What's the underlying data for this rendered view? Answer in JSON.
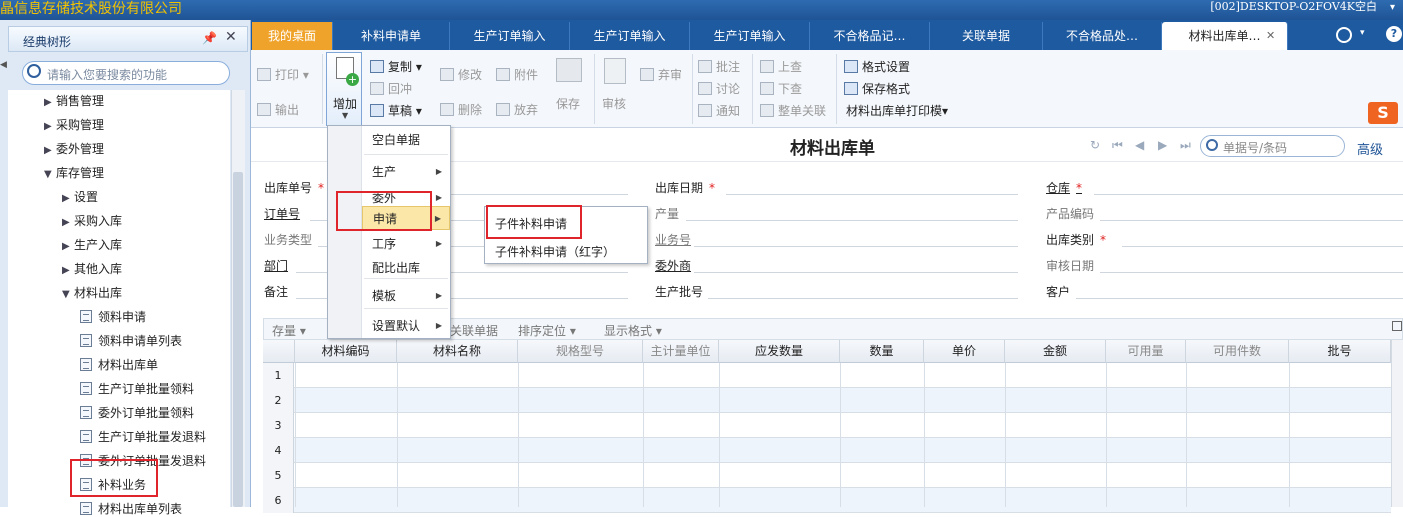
{
  "app": {
    "title": "晶信息存储技术股份有限公司",
    "machine": "[002]DESKTOP-O2FOV4K空白"
  },
  "left_panel": {
    "title": "经典树形",
    "search_placeholder": "请输入您要搜索的功能",
    "tree": [
      {
        "label": "销售管理",
        "level": 1,
        "expanded": false
      },
      {
        "label": "采购管理",
        "level": 1,
        "expanded": false
      },
      {
        "label": "委外管理",
        "level": 1,
        "expanded": false
      },
      {
        "label": "库存管理",
        "level": 1,
        "expanded": true
      },
      {
        "label": "设置",
        "level": 2,
        "expanded": false
      },
      {
        "label": "采购入库",
        "level": 2,
        "expanded": false
      },
      {
        "label": "生产入库",
        "level": 2,
        "expanded": false
      },
      {
        "label": "其他入库",
        "level": 2,
        "expanded": false
      },
      {
        "label": "材料出库",
        "level": 2,
        "expanded": true
      },
      {
        "label": "领料申请",
        "level": 3
      },
      {
        "label": "领料申请单列表",
        "level": 3
      },
      {
        "label": "材料出库单",
        "level": 3
      },
      {
        "label": "生产订单批量领料",
        "level": 3
      },
      {
        "label": "委外订单批量领料",
        "level": 3
      },
      {
        "label": "生产订单批量发退料",
        "level": 3
      },
      {
        "label": "委外订单批量发退料",
        "level": 3
      },
      {
        "label": "补料业务",
        "level": 3,
        "highlighted": true
      },
      {
        "label": "材料出库单列表",
        "level": 3
      }
    ]
  },
  "tabs": [
    "我的桌面",
    "补料申请单",
    "生产订单输入",
    "生产订单输入",
    "生产订单输入",
    "不合格品记…",
    "关联单据",
    "不合格品处…",
    "材料出库单…"
  ],
  "ribbon": {
    "print": "打印",
    "export": "输出",
    "add": "增加",
    "copy": "复制",
    "revert": "回冲",
    "draft": "草稿",
    "modify": "修改",
    "delete": "删除",
    "attach": "附件",
    "abandon": "放弃",
    "save": "保存",
    "audit": "审核",
    "reject": "弃审",
    "annotate": "批注",
    "discuss": "讨论",
    "notify": "通知",
    "up": "上查",
    "down": "下查",
    "link_all": "整单关联",
    "format_setting": "格式设置",
    "save_format": "保存格式",
    "print_template": "材料出库单打印模▾"
  },
  "form": {
    "title": "材料出库单",
    "search_placeholder": "单据号/条码",
    "advanced": "高级",
    "fields": {
      "out_no": "出库单号",
      "out_date": "出库日期",
      "warehouse": "仓库",
      "order_no": "订单号",
      "output": "产量",
      "product_code": "产品编码",
      "biz_type": "业务类型",
      "biz_no": "业务号",
      "out_category": "出库类别",
      "dept": "部门",
      "outsourcer": "委外商",
      "audit_date": "审核日期",
      "remark": "备注",
      "prod_batch": "生产批号",
      "customer": "客户"
    }
  },
  "grid": {
    "toolbar": [
      "存量",
      "关联单据",
      "排序定位",
      "显示格式"
    ],
    "headers": [
      "材料编码",
      "材料名称",
      "规格型号",
      "主计量单位",
      "应发数量",
      "数量",
      "单价",
      "金额",
      "可用量",
      "可用件数",
      "批号"
    ],
    "rows": [
      "1",
      "2",
      "3",
      "4",
      "5",
      "6"
    ]
  },
  "menu": {
    "items": [
      "空白单据",
      "生产",
      "委外",
      "申请",
      "工序",
      "配比出库",
      "模板",
      "设置默认"
    ],
    "submenu": [
      "子件补料申请",
      "子件补料申请（红字）"
    ]
  },
  "colors": {
    "tabbar": "#1e5aa0",
    "home_tab": "#f0a32a",
    "highlight_box": "#e0242c",
    "menu_hover": "#fbe7a8"
  }
}
